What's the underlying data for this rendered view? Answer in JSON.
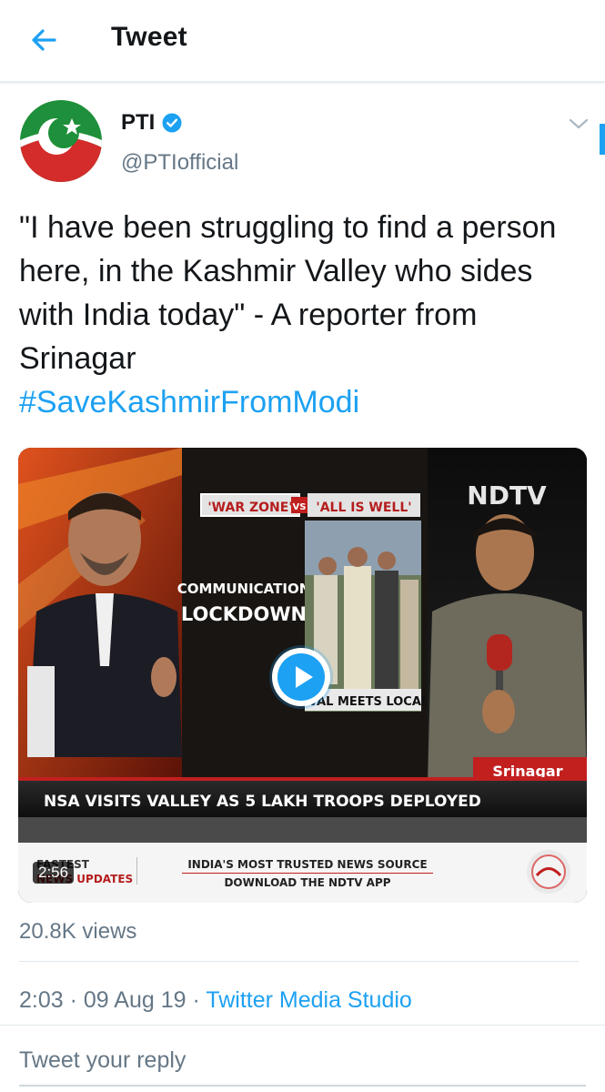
{
  "header": {
    "title": "Tweet"
  },
  "tweet": {
    "name": "PTI",
    "handle": "@PTIofficial",
    "text": "\"I have been struggling to find a person here, in the Kashmir Valley who sides with India today\" - A reporter from Srinagar",
    "hashtag": "#SaveKashmirFromModi",
    "video": {
      "duration": "2:56",
      "overlay": {
        "war_zone": "'WAR ZONE'",
        "vs": "VS",
        "all_is_well": "'ALL IS WELL'",
        "comm_1": "COMMUNICATION",
        "comm_2": "LOCKDOWN",
        "doval": "DOVAL MEETS LOCALS",
        "channel": "NDTV",
        "location": "Srinagar",
        "ticker": "NSA VISITS VALLEY AS 5 LAKH TROOPS DEPLOYED",
        "fastest_1": "FASTEST",
        "fastest_2": "NEWS UPDATES",
        "promo_1": "INDIA'S MOST TRUSTED NEWS SOURCE",
        "promo_2": "DOWNLOAD THE NDTV APP"
      }
    },
    "views": "20.8K views",
    "time": "2:03",
    "date": "09 Aug 19",
    "source": "Twitter Media Studio"
  },
  "reply": {
    "placeholder": "Tweet your reply"
  },
  "colors": {
    "accent": "#1da1f2",
    "muted": "#657786",
    "text": "#14171a"
  },
  "icons": [
    "back-arrow-icon",
    "verified-badge-icon",
    "chevron-down-icon",
    "play-icon"
  ]
}
